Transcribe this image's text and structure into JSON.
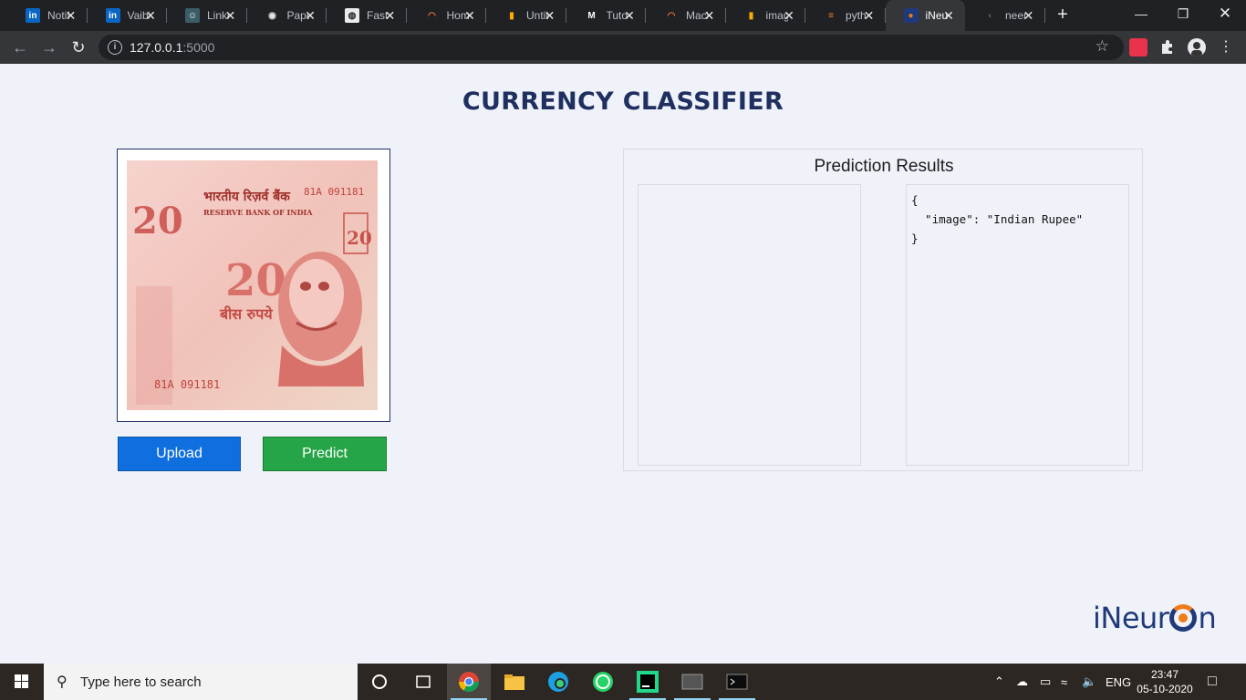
{
  "browser": {
    "tabs": [
      {
        "title": "Notifi",
        "icon": "linkedin-icon"
      },
      {
        "title": "Vaibh",
        "icon": "linkedin-icon"
      },
      {
        "title": "Linke",
        "icon": "avatar-icon"
      },
      {
        "title": "Paper",
        "icon": "paperswithcode-icon"
      },
      {
        "title": "Fast",
        "icon": "globe-icon"
      },
      {
        "title": "Home",
        "icon": "jupyter-icon"
      },
      {
        "title": "Untit",
        "icon": "notebook-icon"
      },
      {
        "title": "Tuto",
        "icon": "medium-icon"
      },
      {
        "title": "Mach",
        "icon": "jupyter-icon"
      },
      {
        "title": "imag",
        "icon": "notebook-icon"
      },
      {
        "title": "pyth",
        "icon": "stackoverflow-icon"
      },
      {
        "title": "iNeu",
        "icon": "ineuron-icon",
        "active": true
      },
      {
        "title": "neer",
        "icon": "github-icon"
      }
    ],
    "url_host": "127.0.0.1",
    "url_port": ":5000"
  },
  "app": {
    "title": "CURRENCY CLASSIFIER",
    "upload_label": "Upload",
    "predict_label": "Predict",
    "results_heading": "Prediction Results",
    "result_json": "{\n  \"image\": \"Indian Rupee\"\n}",
    "logo_prefix": "iNeur",
    "logo_suffix": "n"
  },
  "note_image": {
    "denomination": "20",
    "header_hindi": "भारतीय रिज़र्व बैंक",
    "header_english": "RESERVE BANK OF INDIA",
    "value_hindi": "बीस रुपये",
    "serial": "81A 091181"
  },
  "taskbar": {
    "search_placeholder": "Type here to search",
    "language": "ENG",
    "time": "23:47",
    "date": "05-10-2020"
  },
  "colors": {
    "title": "#1f2f5f",
    "upload": "#0f6fde",
    "predict": "#25a547",
    "background": "#eff2f9"
  }
}
